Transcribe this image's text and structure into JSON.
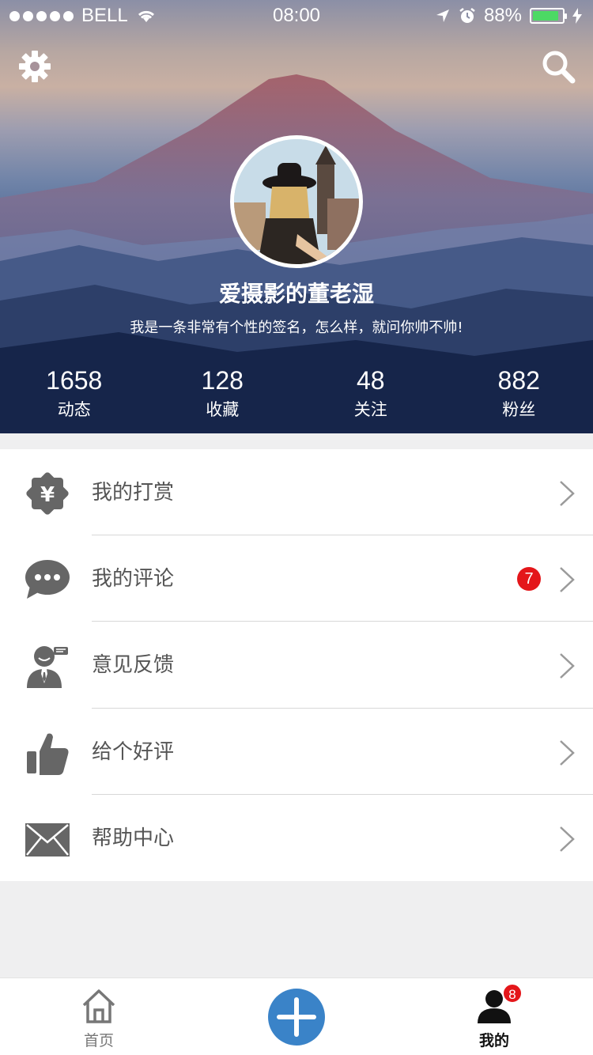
{
  "status_bar": {
    "carrier": "BELL",
    "time": "08:00",
    "battery_percent": "88%",
    "battery_level": 0.88
  },
  "header": {
    "settings_icon": "gear-icon",
    "search_icon": "search-icon"
  },
  "profile": {
    "name": "爱摄影的董老湿",
    "signature": "我是一条非常有个性的签名，怎么样，就问你帅不帅!"
  },
  "stats": [
    {
      "value": "1658",
      "label": "动态"
    },
    {
      "value": "128",
      "label": "收藏"
    },
    {
      "value": "48",
      "label": "关注"
    },
    {
      "value": "882",
      "label": "粉丝"
    }
  ],
  "menu": {
    "items": [
      {
        "label": "我的打赏",
        "icon": "yuan-badge-icon"
      },
      {
        "label": "我的评论",
        "icon": "comment-icon",
        "badge": "7"
      },
      {
        "label": "意见反馈",
        "icon": "feedback-person-icon"
      },
      {
        "label": "给个好评",
        "icon": "thumbs-up-icon"
      },
      {
        "label": "帮助中心",
        "icon": "envelope-icon"
      }
    ]
  },
  "tabbar": {
    "home_label": "首页",
    "me_label": "我的",
    "me_badge": "8"
  },
  "colors": {
    "accent": "#3a83c8",
    "badge": "#e4161a",
    "battery": "#4cd964",
    "icon_gray": "#666666"
  }
}
